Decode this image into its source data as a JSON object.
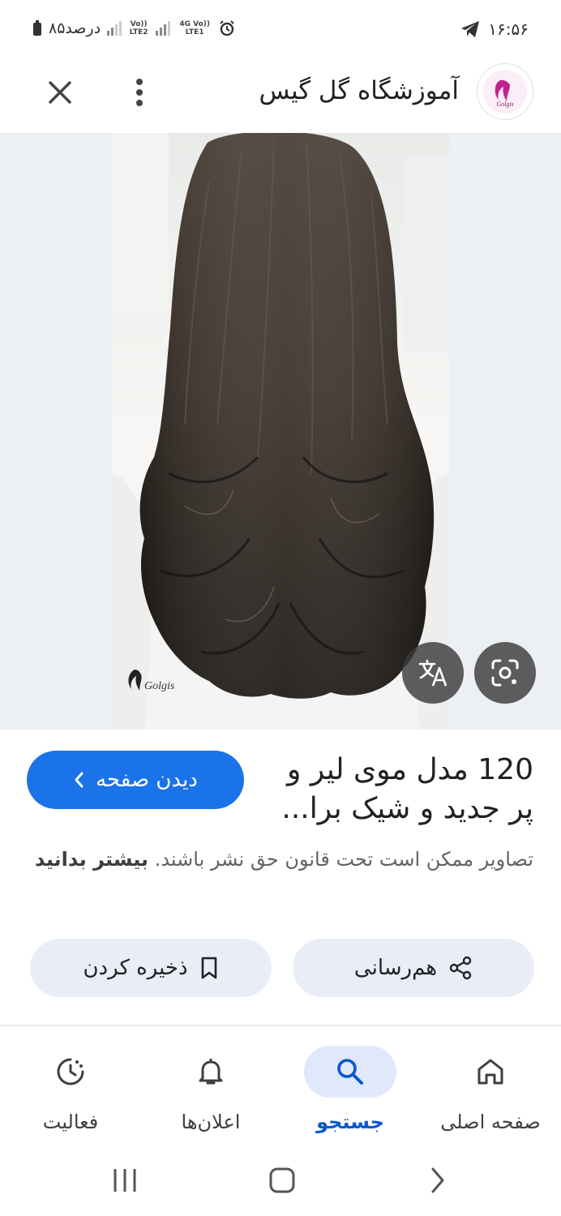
{
  "status_bar": {
    "time": "۱۶:۵۶",
    "battery": "۸۵درصد",
    "sim2_label": "Vo)) LTE2",
    "sim1_label": "4G Vo)) LTE1"
  },
  "header": {
    "site_name": "آموزشگاه گل گیس",
    "logo_text": "Golgis"
  },
  "image": {
    "watermark": "Golgis"
  },
  "result": {
    "title": "120 مدل موی لیر و پر جدید و شیک برا...",
    "visit_label": "دیدن صفحه",
    "copyright_text": "تصاویر ممکن است تحت قانون حق نشر باشند.",
    "learn_more": "بیشتر بدانید"
  },
  "actions": {
    "share_label": "هم‌رسانی",
    "save_label": "ذخیره کردن"
  },
  "bottom_nav": {
    "home": "صفحه اصلی",
    "search": "جستجو",
    "notifications": "اعلان‌ها",
    "activity": "فعالیت",
    "active_tab": "search"
  },
  "colors": {
    "accent": "#1a73e8",
    "chip_bg": "#e9eef6",
    "active_tab_bg": "#dfe9fb",
    "image_bg": "#eceff3"
  }
}
